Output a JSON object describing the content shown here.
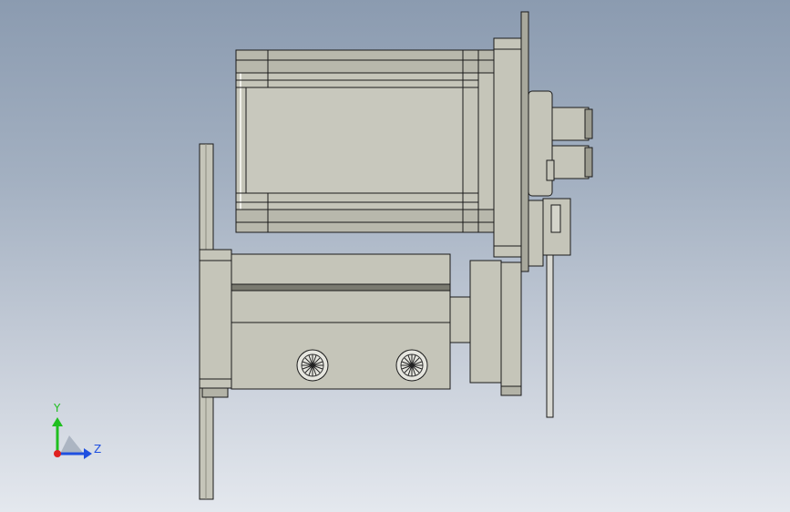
{
  "viewport": {
    "background_top": "#8b9bb0",
    "background_bottom": "#e4e8ee"
  },
  "model": {
    "body_color": "#c5c5b9",
    "shade_color": "#9c9c90",
    "edge_color": "#1a1a1a"
  },
  "triad": {
    "y_label": "Y",
    "z_label": "Z",
    "x_color": "#e02020",
    "y_color": "#1fbf1f",
    "z_color": "#1f4fe0"
  }
}
